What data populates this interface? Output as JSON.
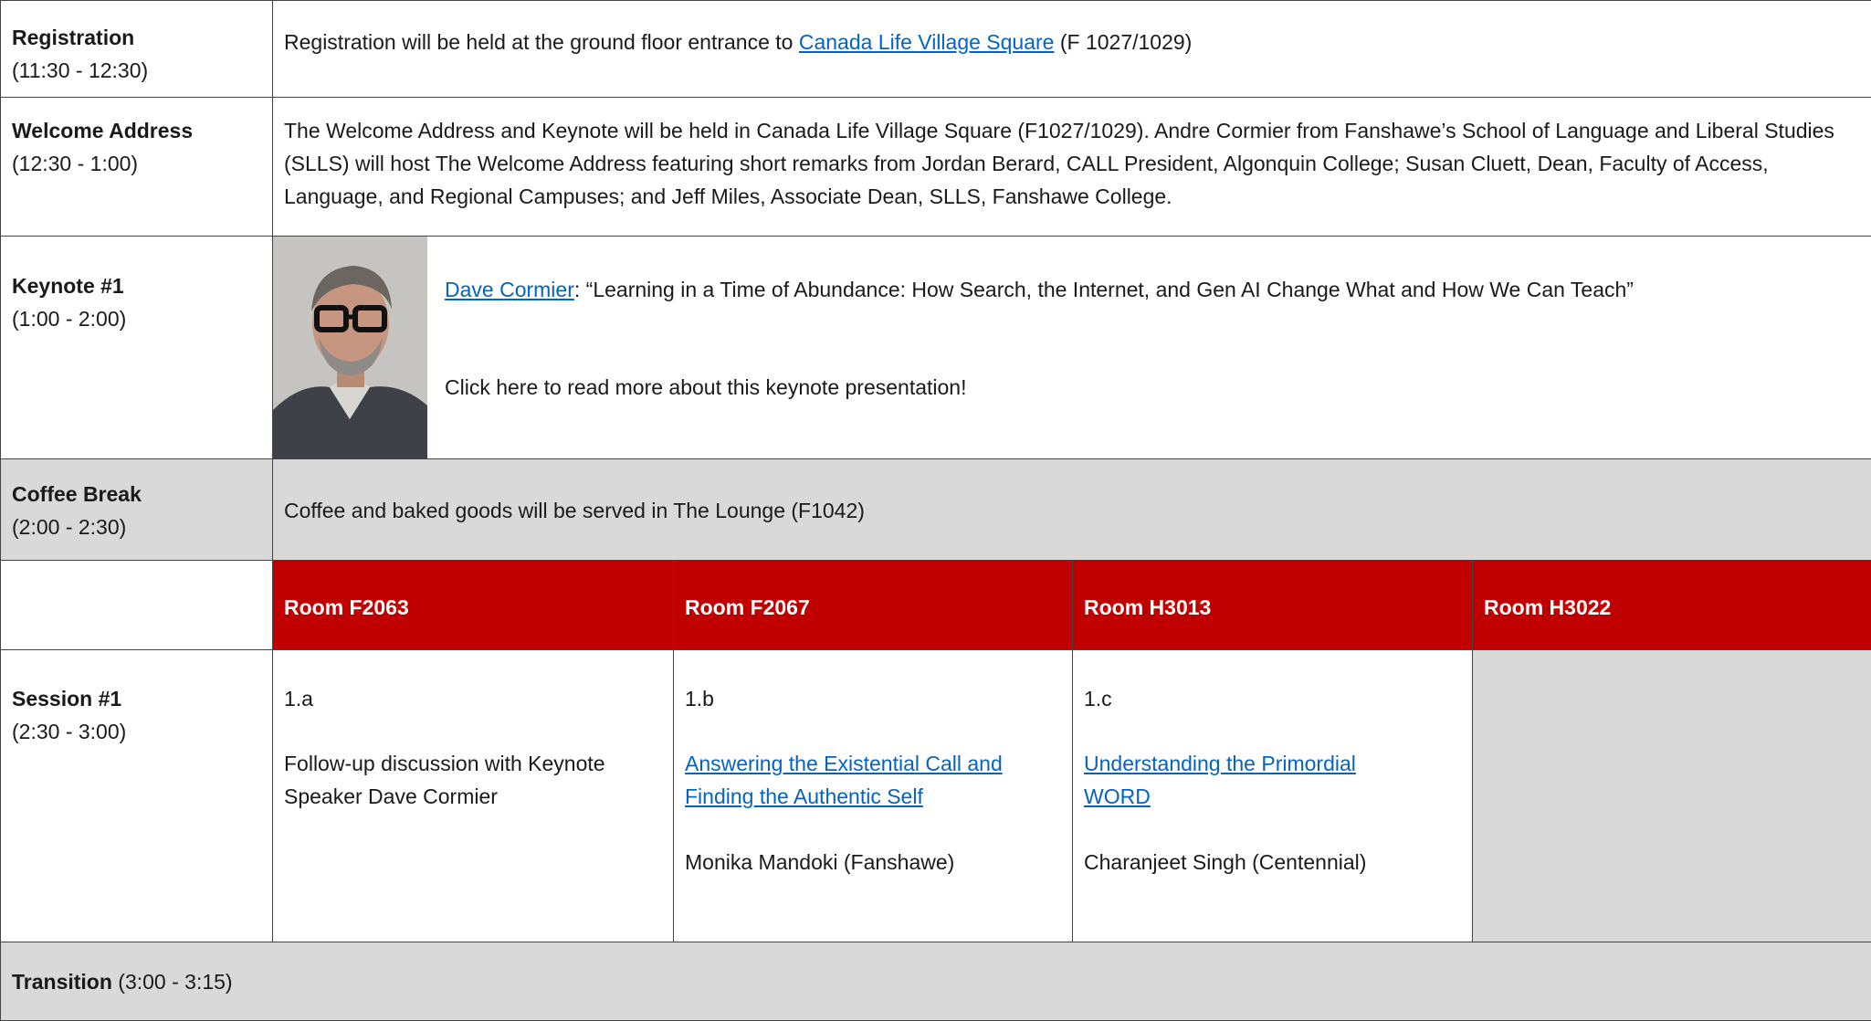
{
  "colors": {
    "header_red": "#c00000",
    "gray_fill": "#d9d9d9",
    "link": "#0563c1"
  },
  "rows": {
    "registration": {
      "title": "Registration",
      "time": "(11:30 - 12:30)",
      "text_before": "Registration will be held at the ground floor entrance to ",
      "link": "Canada Life Village Square",
      "text_after": " (F 1027/1029)"
    },
    "welcome": {
      "title": "Welcome Address",
      "time": "(12:30 - 1:00)",
      "text": "The Welcome Address and Keynote will be held in Canada Life Village Square (F1027/1029). Andre Cormier from Fanshawe’s School of Language and Liberal Studies (SLLS) will host The Welcome Address featuring short remarks from Jordan Berard, CALL President, Algonquin College; Susan Cluett, Dean, Faculty of Access, Language, and Regional Campuses; and Jeff Miles, Associate Dean, SLLS, Fanshawe College."
    },
    "keynote": {
      "title": "Keynote #1",
      "time": "(1:00 - 2:00)",
      "speaker_link": "Dave Cormier",
      "talk_title": ": “Learning in a Time of Abundance: How Search, the Internet, and Gen AI Change What and How We Can Teach”",
      "more": "Click here to read more about this keynote presentation!"
    },
    "coffee": {
      "title": "Coffee Break",
      "time": "(2:00 - 2:30)",
      "text": "Coffee and baked goods will be served in The Lounge (F1042)"
    },
    "rooms": [
      "Room F2063",
      "Room F2067",
      "Room H3013",
      "Room H3022"
    ],
    "session1": {
      "title": "Session #1",
      "time": "(2:30 - 3:00)",
      "a": {
        "code": "1.a",
        "text": "Follow-up discussion with Keynote Speaker Dave Cormier"
      },
      "b": {
        "code": "1.b",
        "link": "Answering the Existential Call and Finding the Authentic Self",
        "presenter": "Monika Mandoki (Fanshawe)"
      },
      "c": {
        "code": "1.c",
        "link": "Understanding the Primordial WORD",
        "presenter": "Charanjeet Singh (Centennial)"
      }
    },
    "transition": {
      "title": "Transition",
      "time": " (3:00 - 3:15)"
    }
  }
}
